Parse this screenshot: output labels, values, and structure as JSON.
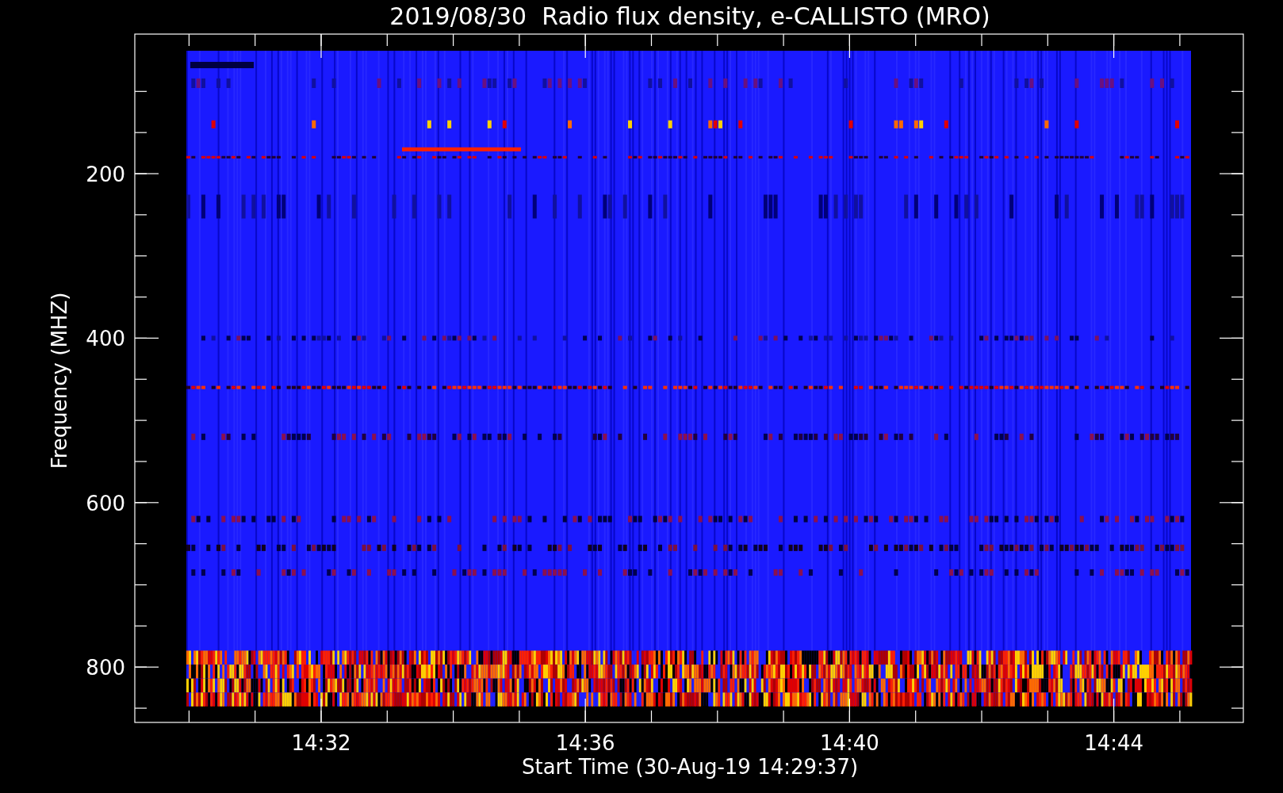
{
  "title": "2019/08/30  Radio flux density, e-CALLISTO (MRO)",
  "x_axis": {
    "label": "Start Time (30-Aug-19 14:29:37)",
    "ticks": [
      "14:32",
      "14:36",
      "14:40",
      "14:44"
    ]
  },
  "y_axis": {
    "label": "Frequency (MHZ)",
    "ticks": [
      "200",
      "400",
      "600",
      "800"
    ]
  }
}
